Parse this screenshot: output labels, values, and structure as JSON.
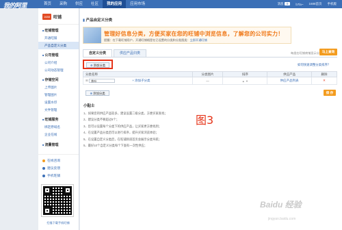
{
  "topbar": {
    "logo": "我的阿里",
    "nav": [
      "首页",
      "采购",
      "供应",
      "社区",
      "我的应用",
      "应用市场"
    ],
    "active_nav": "我的应用",
    "message_label": "消息",
    "message_count": "0",
    "user": "b7la~",
    "links": [
      "1688首页",
      "手机版"
    ]
  },
  "sidebar": {
    "brand_logo": "1688",
    "brand_name": "旺铺",
    "groups": [
      {
        "title": "旺铺管理",
        "items": [
          "开通旺铺",
          "产品自定义分类"
        ]
      },
      {
        "title": "公司管理",
        "items": [
          "公司介绍",
          "公司动态管理"
        ]
      },
      {
        "title": "存储空间",
        "items": [
          "上传图片",
          "管理图片",
          "设置水印",
          "文件管理"
        ]
      },
      {
        "title": "旺铺服务",
        "items": [
          "绑定原域名",
          "企业在线"
        ]
      }
    ],
    "active_item": "产品自定义分类",
    "extra": "流量管理",
    "misc": [
      "在线咨询",
      "建议反馈",
      "手机旺铺"
    ],
    "qr_caption": "扫描下载手机旺铺"
  },
  "main": {
    "breadcrumb": "产品自定义分类",
    "banner": {
      "headline": "管理好信息分类，方便买家在您的旺铺中浏览信息，了解您的公司实力！",
      "tip_prefix": "提醒：在下载旺铺用户，开通旺铺格是在已设置的分类和分类图类：",
      "tip_link": "立即开通旺铺"
    },
    "tabs": [
      "自定义分类",
      "供应产品归类"
    ],
    "active_tab": "自定义分类",
    "tab_note": "每类在旺铺商铺显示分类",
    "online_button": "马上查询",
    "add_category_button": "添加分类",
    "side_link": "如何快速调整分类排序？",
    "table": {
      "headers": [
        "分类名称",
        "分类图片",
        "排序",
        "供应产品",
        "删除"
      ],
      "row": {
        "name": "茶叶",
        "add_sub": "添加子分类",
        "image": "",
        "product_link": "供应产品列表"
      }
    },
    "add_category_button_2": "添加分类",
    "save_button": "保 存",
    "tips_title": "小贴士",
    "tips": [
      "1、如果您的供应产品较多，建议设置二级分类，方便买家查找；",
      "2、建议分类不要超过8个；",
      "3、您可以设置每个分类下的供应产品，让买家更方便找到；",
      "4、在设置产品分类后可以进行排序，提升买家浏览体验；",
      "5、在设置自定义分类后，在旺铺频道首页会展示分类导航；",
      "5、最好10个自定义分类每个下面有一次性供应；"
    ],
    "figure_label": "图3"
  },
  "watermark": {
    "brand": "Baidu 经验",
    "url": "jingyan.baidu.com"
  },
  "colors": {
    "topbar": "#3b6fb6",
    "accent_orange": "#f39c1f",
    "highlight_red": "#e53318"
  }
}
